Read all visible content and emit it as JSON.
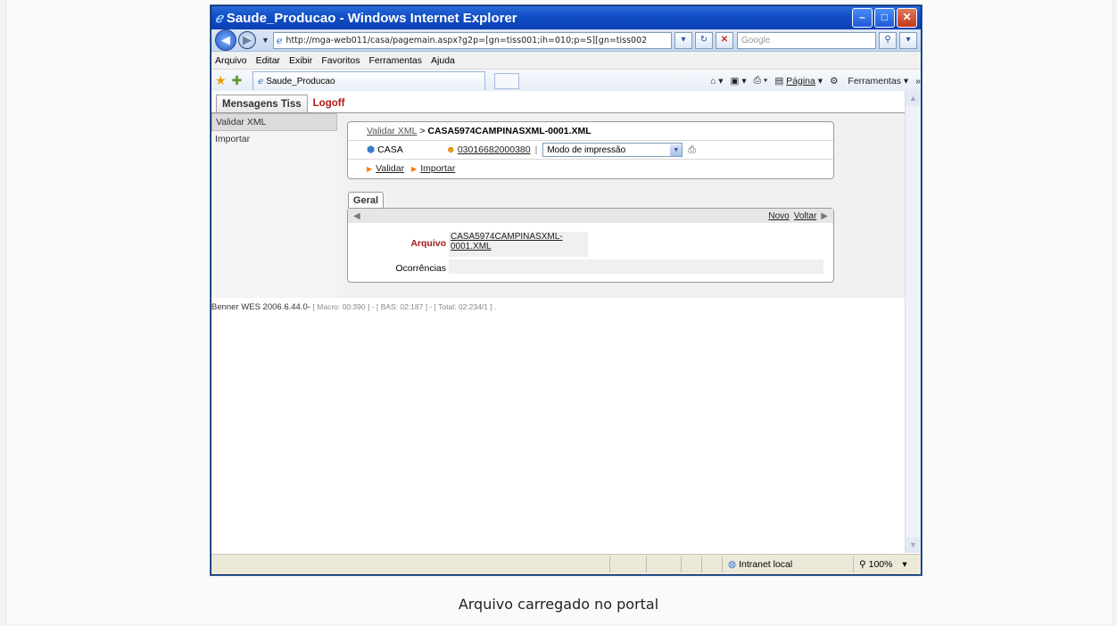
{
  "window": {
    "title": "Saude_Producao - Windows Internet Explorer",
    "minimize": "–",
    "maximize": "□",
    "close": "✕"
  },
  "address": {
    "url": "http://mga-web011/casa/pagemain.aspx?g2p=[gn=tiss001;ih=010;p=S][gn=tiss002",
    "search_placeholder": "Google"
  },
  "menu": [
    "Arquivo",
    "Editar",
    "Exibir",
    "Favoritos",
    "Ferramentas",
    "Ajuda"
  ],
  "favbar": {
    "tab_label": "Saude_Producao",
    "pagina": "Página",
    "ferramentas": "Ferramentas"
  },
  "app": {
    "tabs": {
      "mensagens": "Mensagens Tiss",
      "logoff": "Logoff"
    },
    "sidebar": [
      {
        "label": "Validar XML",
        "selected": true
      },
      {
        "label": "Importar",
        "selected": false
      }
    ],
    "breadcrumb": {
      "link": "Validar XML",
      "sep": " > ",
      "current": "CASA5974CAMPINASXML-0001.XML"
    },
    "info": {
      "company": "CASA",
      "user": "03016682000380",
      "sep": "|",
      "mode": "Modo de impressão"
    },
    "actions": [
      "Validar",
      "Importar"
    ],
    "form": {
      "tab": "Geral",
      "novo": "Novo",
      "voltar": "Voltar",
      "arquivo_label": "Arquivo",
      "arquivo_value_1": "CASA5974CAMPINASXML-",
      "arquivo_value_2": "0001.XML",
      "ocorrencias_label": "Ocorrências",
      "ocorrencias_value": ""
    },
    "footer": {
      "version": "Benner WES 2006.6.44.0-",
      "stats": "[ Macro: 00:390 ] - [ BAS: 02:187 ] - [ Total: 02:234/1 ] ."
    }
  },
  "status": {
    "zone": "Intranet local",
    "zoom": "100%"
  },
  "caption": "Arquivo carregado no portal"
}
